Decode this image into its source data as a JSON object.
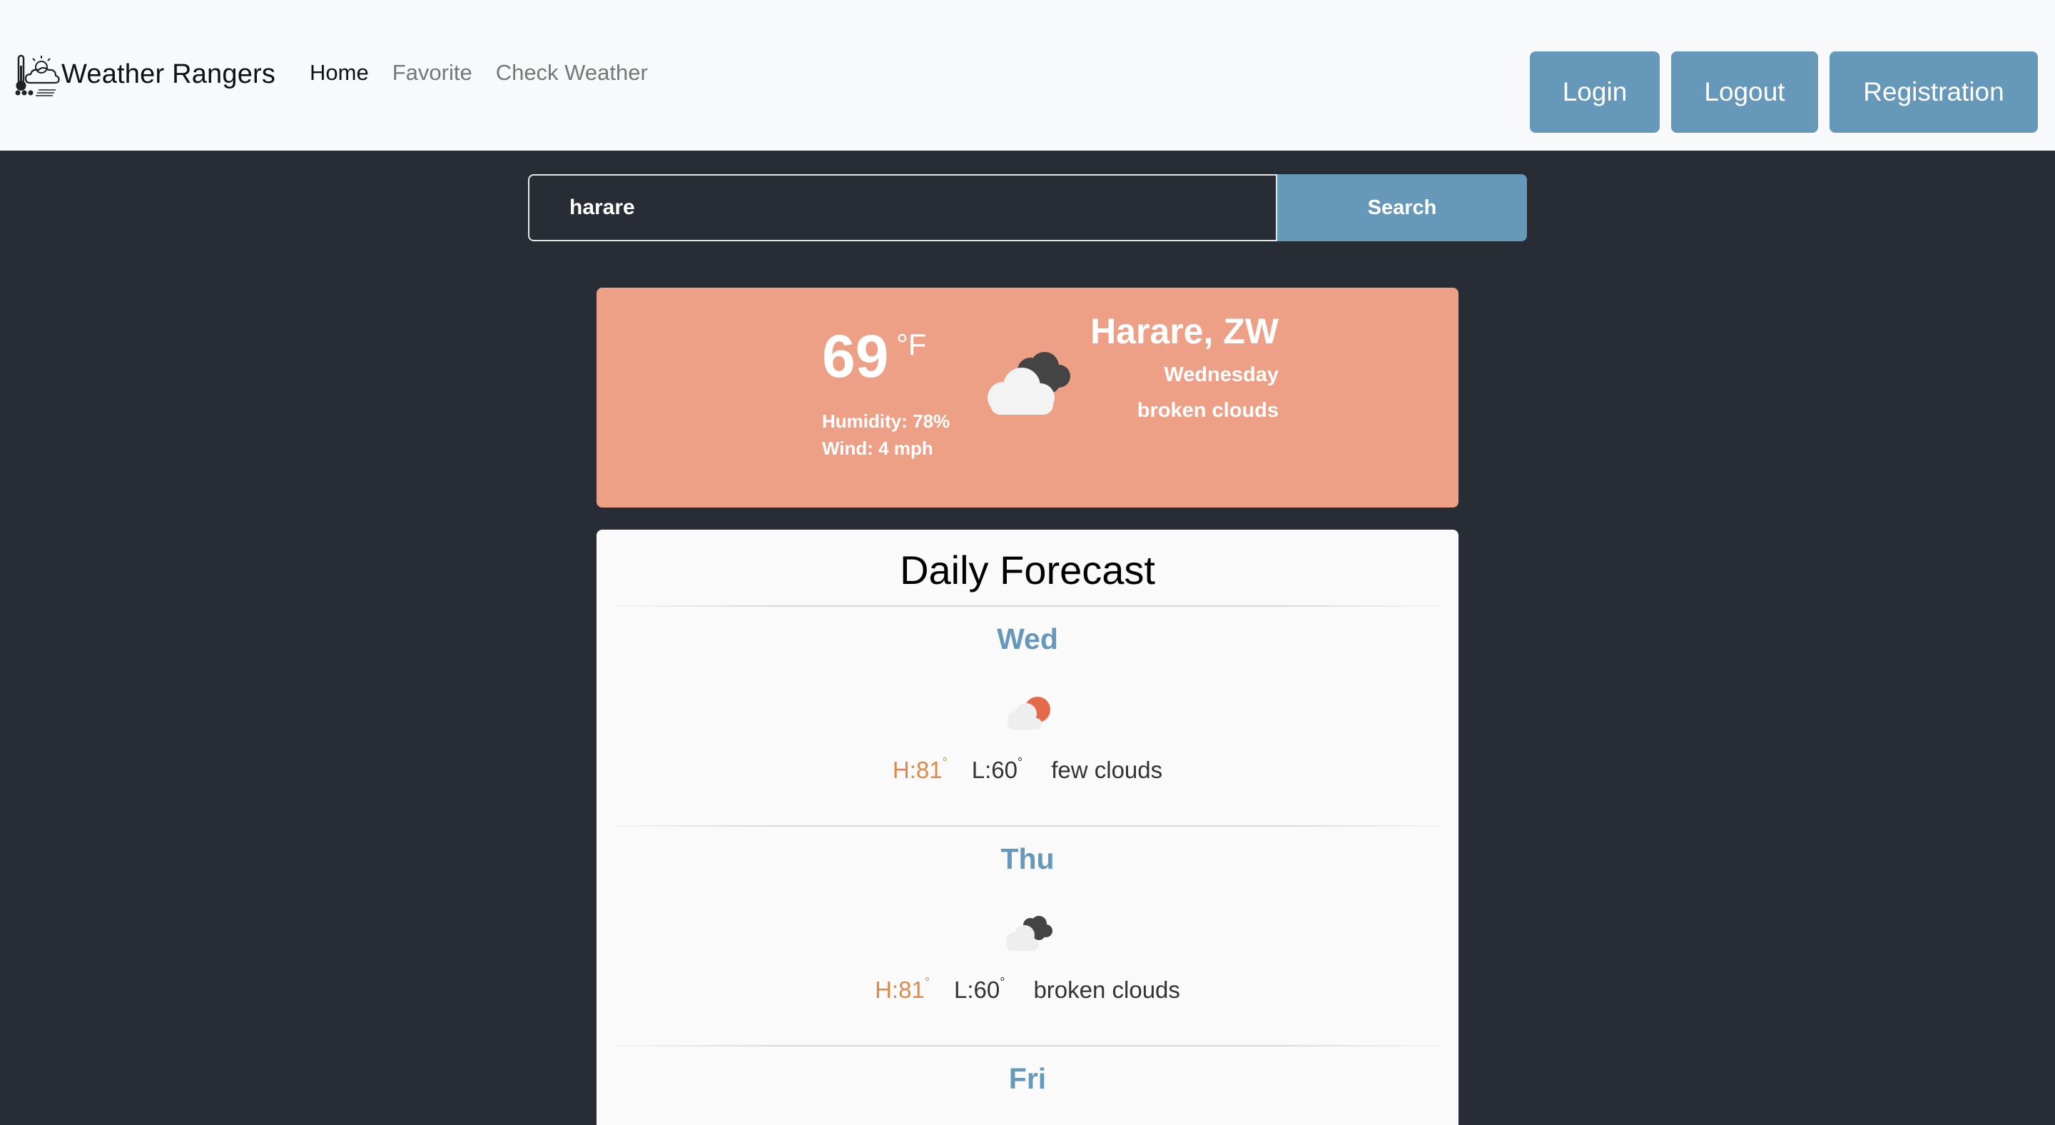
{
  "nav": {
    "brand": "Weather Rangers",
    "links": [
      "Home",
      "Favorite",
      "Check Weather"
    ],
    "buttons": {
      "login": "Login",
      "logout": "Logout",
      "registration": "Registration"
    }
  },
  "search": {
    "value": "harare",
    "button": "Search"
  },
  "current": {
    "temp": "69",
    "unit": "°F",
    "humidity": "Humidity: 78%",
    "wind": "Wind: 4 mph",
    "city": "Harare, ZW",
    "day": "Wednesday",
    "description": "broken clouds",
    "icon": "broken-clouds-icon"
  },
  "forecast": {
    "title": "Daily Forecast",
    "days": [
      {
        "day": "Wed",
        "hi": "H:81",
        "lo": "L:60",
        "deg": "°",
        "desc": "few clouds",
        "icon": "few-clouds-icon"
      },
      {
        "day": "Thu",
        "hi": "H:81",
        "lo": "L:60",
        "deg": "°",
        "desc": "broken clouds",
        "icon": "broken-clouds-icon"
      },
      {
        "day": "Fri"
      }
    ]
  },
  "colors": {
    "accent": "#6698ba",
    "card": "#eea087",
    "background": "#282c34",
    "high": "#e08a4a"
  }
}
